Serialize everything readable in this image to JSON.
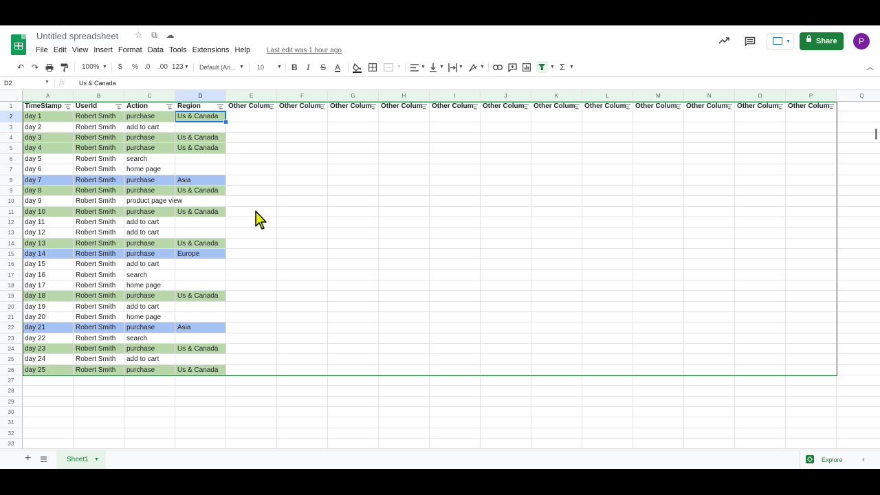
{
  "window": {
    "title": "Untitled spreadsheet",
    "last_edit": "Last edit was 1 hour ago"
  },
  "menu": [
    "File",
    "Edit",
    "View",
    "Insert",
    "Format",
    "Data",
    "Tools",
    "Extensions",
    "Help"
  ],
  "title_icons": [
    "star-icon",
    "move-icon",
    "cloud-status-icon"
  ],
  "header_actions": {
    "share_label": "Share",
    "avatar_initial": "P",
    "icons": [
      "trend-icon",
      "comment-icon",
      "present-icon"
    ]
  },
  "toolbar": {
    "zoom": "100%",
    "currency": "$",
    "percent": "%",
    "dec_decrease": ".0",
    "dec_increase": ".00",
    "more_formats": "123",
    "font": "Default (Ari...",
    "font_size": "10",
    "bold": "B",
    "italic": "I",
    "strike": "S",
    "text_color": "A",
    "sum": "Σ"
  },
  "formula_bar": {
    "cell_ref": "D2",
    "fx": "fx",
    "value": "Us & Canada"
  },
  "columns": [
    "A",
    "B",
    "C",
    "D",
    "E",
    "F",
    "G",
    "H",
    "I",
    "J",
    "K",
    "L",
    "M",
    "N",
    "O",
    "P",
    "Q"
  ],
  "row_numbers": [
    "1",
    "2",
    "3",
    "4",
    "5",
    "6",
    "7",
    "8",
    "9",
    "10",
    "11",
    "12",
    "13",
    "14",
    "15",
    "16",
    "17",
    "18",
    "19",
    "20",
    "21",
    "22",
    "23",
    "24",
    "25",
    "26",
    "27",
    "28",
    "29",
    "30",
    "31",
    "32",
    "33"
  ],
  "headers": [
    "TimeStamp",
    "UserId",
    "Action",
    "Region",
    "Other Colum",
    "Other Colum",
    "Other Colum",
    "Other Colum",
    "Other Colum",
    "Other Colum",
    "Other Colum",
    "Other Colum",
    "Other Colum",
    "Other Colum",
    "Other Colum",
    "Other Colum"
  ],
  "rows": [
    {
      "ts": "day 1",
      "user": "Robert Smith",
      "action": "purchase",
      "region": "Us & Canada",
      "color": "green"
    },
    {
      "ts": "day 2",
      "user": "Robert Smith",
      "action": "add to cart",
      "region": "",
      "color": ""
    },
    {
      "ts": "day 3",
      "user": "Robert Smith",
      "action": "purchase",
      "region": "Us & Canada",
      "color": "green"
    },
    {
      "ts": "day 4",
      "user": "Robert Smith",
      "action": "purchase",
      "region": "Us & Canada",
      "color": "green"
    },
    {
      "ts": "day 5",
      "user": "Robert Smith",
      "action": "search",
      "region": "",
      "color": ""
    },
    {
      "ts": "day 6",
      "user": "Robert Smith",
      "action": "home page",
      "region": "",
      "color": ""
    },
    {
      "ts": "day 7",
      "user": "Robert Smith",
      "action": "purchase",
      "region": "Asia",
      "color": "blue"
    },
    {
      "ts": "day 8",
      "user": "Robert Smith",
      "action": "purchase",
      "region": "Us & Canada",
      "color": "green"
    },
    {
      "ts": "day 9",
      "user": "Robert Smith",
      "action": "product page view",
      "region": "",
      "color": ""
    },
    {
      "ts": "day 10",
      "user": "Robert Smith",
      "action": "purchase",
      "region": "Us & Canada",
      "color": "green"
    },
    {
      "ts": "day 11",
      "user": "Robert Smith",
      "action": "add to cart",
      "region": "",
      "color": ""
    },
    {
      "ts": "day 12",
      "user": "Robert Smith",
      "action": "add to cart",
      "region": "",
      "color": ""
    },
    {
      "ts": "day 13",
      "user": "Robert Smith",
      "action": "purchase",
      "region": "Us & Canada",
      "color": "green"
    },
    {
      "ts": "day 14",
      "user": "Robert Smith",
      "action": "purchase",
      "region": "Europe",
      "color": "blue"
    },
    {
      "ts": "day 15",
      "user": "Robert Smith",
      "action": "add to cart",
      "region": "",
      "color": ""
    },
    {
      "ts": "day 16",
      "user": "Robert Smith",
      "action": "search",
      "region": "",
      "color": ""
    },
    {
      "ts": "day 17",
      "user": "Robert Smith",
      "action": "home page",
      "region": "",
      "color": ""
    },
    {
      "ts": "day 18",
      "user": "Robert Smith",
      "action": "purchase",
      "region": "Us & Canada",
      "color": "green"
    },
    {
      "ts": "day 19",
      "user": "Robert Smith",
      "action": "add to cart",
      "region": "",
      "color": ""
    },
    {
      "ts": "day 20",
      "user": "Robert Smith",
      "action": "home page",
      "region": "",
      "color": ""
    },
    {
      "ts": "day 21",
      "user": "Robert Smith",
      "action": "purchase",
      "region": "Asia",
      "color": "blue"
    },
    {
      "ts": "day 22",
      "user": "Robert Smith",
      "action": "search",
      "region": "",
      "color": ""
    },
    {
      "ts": "day 23",
      "user": "Robert Smith",
      "action": "purchase",
      "region": "Us & Canada",
      "color": "green"
    },
    {
      "ts": "day 24",
      "user": "Robert Smith",
      "action": "add to cart",
      "region": "",
      "color": ""
    },
    {
      "ts": "day 25",
      "user": "Robert Smith",
      "action": "purchase",
      "region": "Us & Canada",
      "color": "green"
    }
  ],
  "colors": {
    "green_fill": "#b7d7a8",
    "blue_fill": "#a4c2f4",
    "accent": "#188038",
    "selection": "#1a73e8"
  },
  "bottom": {
    "sheet_name": "Sheet1",
    "explore_label": "Explore"
  }
}
